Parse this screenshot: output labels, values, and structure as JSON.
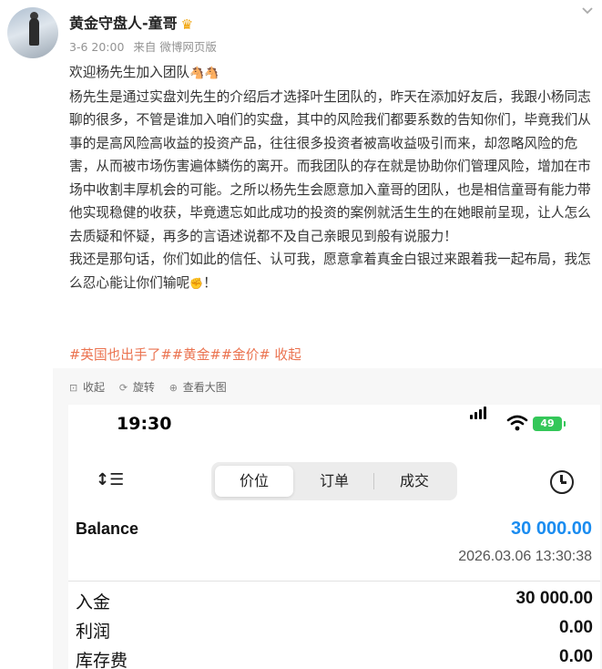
{
  "post": {
    "author": "黄金守盘人-童哥",
    "time": "3-6 20:00",
    "source_prefix": "来自",
    "source": "微博网页版",
    "more_icon": "chevron-down-icon",
    "lines": [
      {
        "text": "欢迎杨先生加入团队",
        "emoji": "🐴🐴"
      },
      {
        "text": "杨先生是通过实盘刘先生的介绍后才选择叶生团队的，昨天在添加好友后，我跟小杨同志聊的很多，不管是谁加入咱们的实盘，其中的风险我们都要系数的告知你们，毕竟我们从事的是高风险高收益的投资产品，往往很多投资者被高收益吸引而来，却忽略风险的危害，从而被市场伤害遍体鳞伤的离开。而我团队的存在就是协助你们管理风险，增加在市场中收割丰厚机会的可能。之所以杨先生会愿意加入童哥的团队，也是相信童哥有能力带他实现稳健的收获，毕竟遗忘如此成功的投资的案例就活生生的在她眼前呈现，让人怎么去质疑和怀疑，再多的言语述说都不及自己亲眼见到般有说服力！"
      },
      {
        "text": "我还是那句话，你们如此的信任、认可我，愿意拿着真金白银过来跟着我一起布局，我怎么忍心能让你们输呢",
        "emoji": "✊",
        "tail": "！"
      }
    ],
    "tags": [
      "#英国也出手了#",
      "#黄金#",
      "#金价#",
      " 收起"
    ]
  },
  "media_toolbar": {
    "collapse": "收起",
    "rotate": "旋转",
    "view_large": "查看大图"
  },
  "phone": {
    "status_time": "19:30",
    "battery": "49",
    "tabs": [
      "价位",
      "订单",
      "成交"
    ],
    "active_tab": 0,
    "balance_label": "Balance",
    "balance_value": "30 000.00",
    "balance_date": "2026.03.06 13:30:38",
    "rows": [
      {
        "label": "入金",
        "value": "30 000.00"
      },
      {
        "label": "利润",
        "value": "0.00"
      },
      {
        "label": "库存费",
        "value": "0.00"
      }
    ]
  },
  "colors": {
    "tag": "#eb7350",
    "balance": "#1a8cf0",
    "battery": "#34c759"
  }
}
